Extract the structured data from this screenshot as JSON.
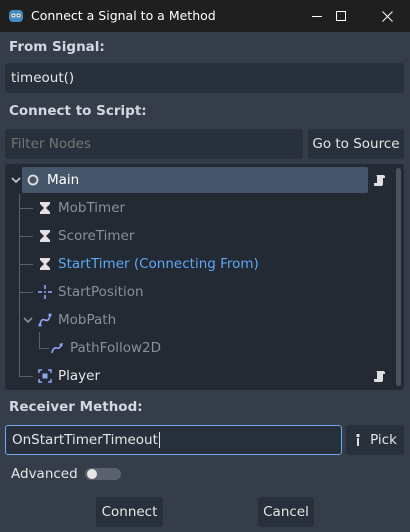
{
  "window": {
    "title": "Connect a Signal to a Method",
    "minimize_icon": "minimize-icon",
    "maximize_icon": "maximize-icon",
    "close_icon": "close-icon"
  },
  "from_signal": {
    "label": "From Signal:",
    "value": "timeout()"
  },
  "connect_to_script": {
    "label": "Connect to Script:",
    "filter_placeholder": "Filter Nodes",
    "goto_source_label": "Go to Source"
  },
  "tree": {
    "nodes": [
      {
        "name": "Main",
        "icon": "node-circle-icon",
        "selected": true,
        "has_script": true,
        "expanded": true
      },
      {
        "name": "MobTimer",
        "icon": "timer-icon",
        "dimmed": true
      },
      {
        "name": "ScoreTimer",
        "icon": "timer-icon",
        "dimmed": true
      },
      {
        "name": "StartTimer (Connecting From)",
        "icon": "timer-icon",
        "highlight": true
      },
      {
        "name": "StartPosition",
        "icon": "marker2d-icon",
        "dimmed": true
      },
      {
        "name": "MobPath",
        "icon": "path2d-icon",
        "dimmed": true,
        "expanded": true
      },
      {
        "name": "PathFollow2D",
        "icon": "pathfollow2d-icon",
        "dimmed": true
      },
      {
        "name": "Player",
        "icon": "area2d-icon",
        "has_script": true
      }
    ]
  },
  "receiver": {
    "label": "Receiver Method:",
    "value": "OnStartTimerTimeout",
    "pick_label": "Pick"
  },
  "advanced": {
    "label": "Advanced",
    "enabled": false
  },
  "footer": {
    "connect_label": "Connect",
    "cancel_label": "Cancel"
  },
  "colors": {
    "background": "#363d4a",
    "field": "#28303b",
    "tree_bg": "#232a34",
    "selection": "#45556a",
    "highlight_text": "#5ea8f5",
    "focus_border": "#6eaaf0"
  }
}
